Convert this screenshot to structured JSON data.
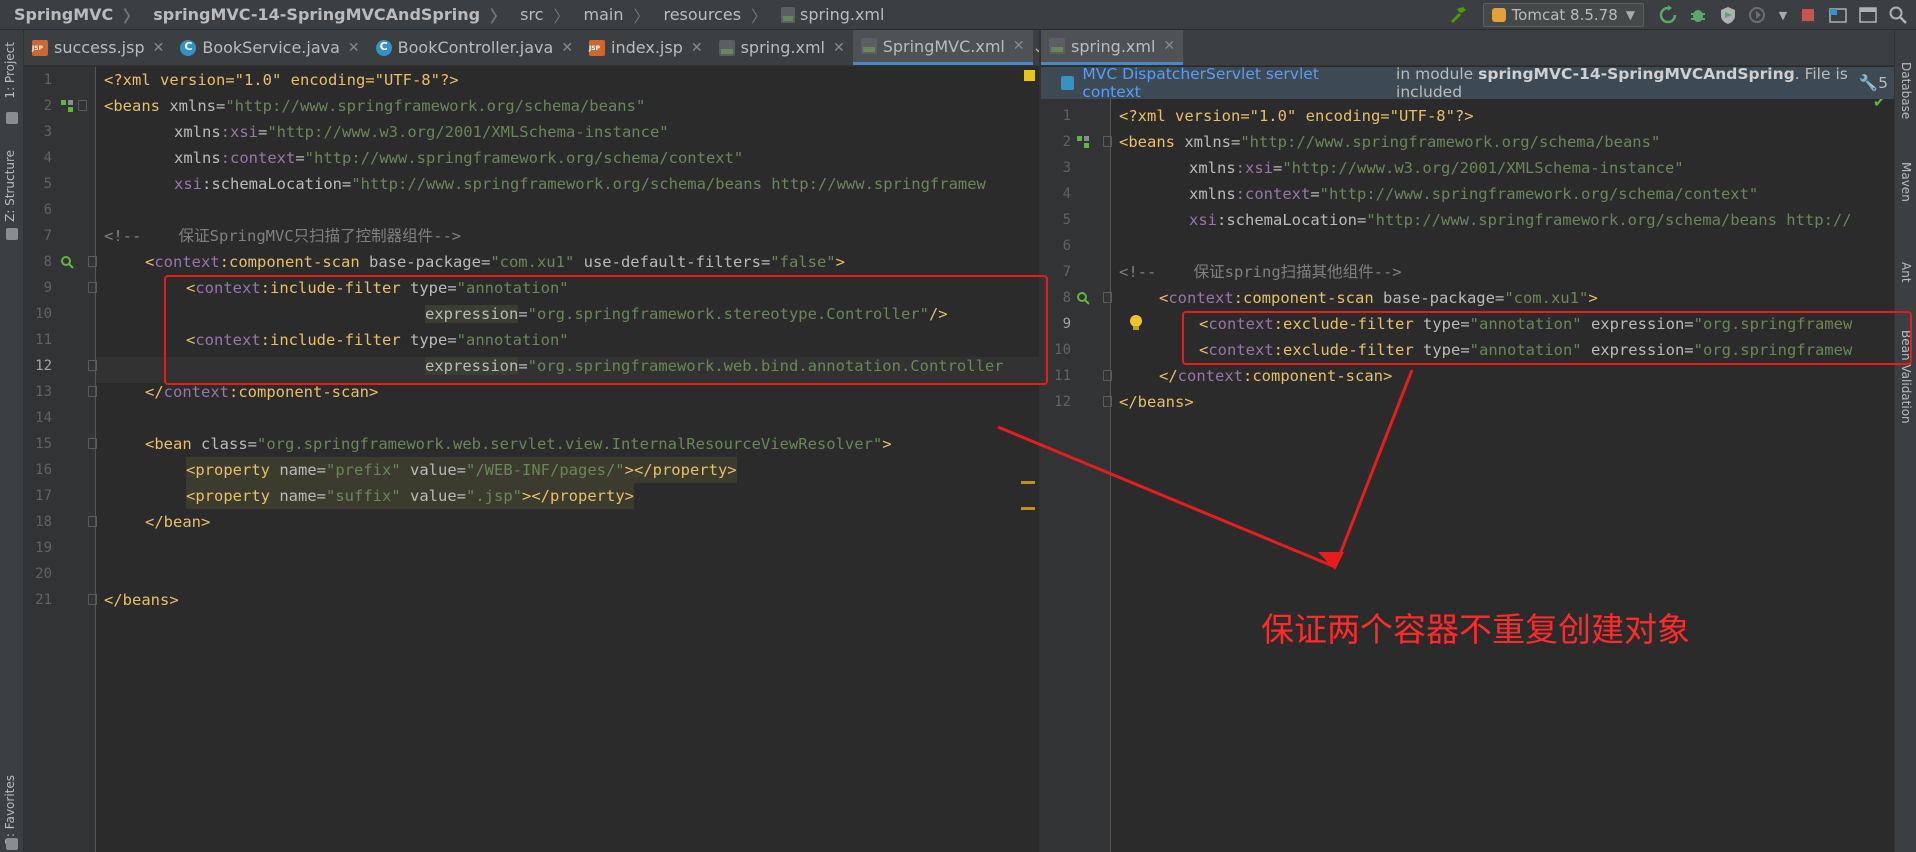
{
  "breadcrumb": [
    "SpringMVC",
    "springMVC-14-SpringMVCAndSpring",
    "src",
    "main",
    "resources",
    "spring.xml"
  ],
  "toolbar": {
    "run_config": "Tomcat 8.5.78"
  },
  "left_tools": [
    "1: Project",
    "Z: Structure",
    "2: Favorites"
  ],
  "right_tools": [
    "Database",
    "Maven",
    "Ant",
    "Bean Validation"
  ],
  "left_tabs": [
    {
      "label": "success.jsp",
      "icon": "jsp"
    },
    {
      "label": "BookService.java",
      "icon": "java"
    },
    {
      "label": "BookController.java",
      "icon": "java"
    },
    {
      "label": "index.jsp",
      "icon": "jsp"
    },
    {
      "label": "spring.xml",
      "icon": "xml"
    },
    {
      "label": "SpringMVC.xml",
      "icon": "xml"
    }
  ],
  "right_tabs": [
    {
      "label": "spring.xml",
      "icon": "xml"
    }
  ],
  "banner": {
    "context": "MVC DispatcherServlet servlet context",
    "module_prefix": "in module ",
    "module_name": "springMVC-14-SpringMVCAndSpring",
    "module_suffix": ". File is included",
    "count": "5"
  },
  "left_lines": [
    "1",
    "2",
    "3",
    "4",
    "5",
    "6",
    "7",
    "8",
    "9",
    "10",
    "11",
    "12",
    "13",
    "14",
    "15",
    "16",
    "17",
    "18",
    "19",
    "20",
    "21"
  ],
  "left_code": {
    "l1": "<?xml version=\"1.0\" encoding=\"UTF-8\"?>",
    "l2a": "<beans ",
    "l2b": "xmlns",
    "l2c": "=",
    "l2d": "\"http://www.springframework.org/schema/beans\"",
    "l3a": "xmlns",
    "l3b": ":xsi",
    "l3c": "=",
    "l3d": "\"http://www.w3.org/2001/XMLSchema-instance\"",
    "l4a": "xmlns",
    "l4b": ":context",
    "l4c": "=",
    "l4d": "\"http://www.springframework.org/schema/context\"",
    "l5a": "xsi",
    "l5b": ":schemaLocation",
    "l5c": "=",
    "l5d": "\"http://www.springframework.org/schema/beans http://www.springframew",
    "l7": "<!--    保证SpringMVC只扫描了控制器组件-->",
    "l8a": "<",
    "l8b": "context",
    "l8c": ":component-scan ",
    "l8d": "base-package",
    "l8e": "=",
    "l8f": "\"com.xu1\"",
    "l8g": " use-default-filters",
    "l8h": "=",
    "l8i": "\"false\"",
    "l8j": ">",
    "l9a": "<",
    "l9b": "context",
    "l9c": ":include-filter ",
    "l9d": "type",
    "l9e": "=",
    "l9f": "\"annotation\"",
    "l10a": "expression",
    "l10b": "=",
    "l10c": "\"org.springframework.stereotype.Controller\"",
    "l10d": "/>",
    "l11a": "<",
    "l11b": "context",
    "l11c": ":include-filter ",
    "l11d": "type",
    "l11e": "=",
    "l11f": "\"annotation\"",
    "l12a": "expression",
    "l12b": "=",
    "l12c": "\"org.springframework.web.bind.annotation.Controller",
    "l13a": "</",
    "l13b": "context",
    "l13c": ":component-scan>",
    "l15a": "<bean ",
    "l15b": "class",
    "l15c": "=",
    "l15d": "\"org.springframework.web.servlet.view.InternalResourceViewResolver\"",
    "l15e": ">",
    "l16a": "<property ",
    "l16b": "name",
    "l16c": "=",
    "l16d": "\"prefix\"",
    "l16e": " value",
    "l16f": "=",
    "l16g": "\"/WEB-INF/pages/\"",
    "l16h": "></property>",
    "l17a": "<property ",
    "l17b": "name",
    "l17c": "=",
    "l17d": "\"suffix\"",
    "l17e": " value",
    "l17f": "=",
    "l17g": "\".jsp\"",
    "l17h": "></property>",
    "l18": "</bean>",
    "l21": "</beans>"
  },
  "right_lines": [
    "1",
    "2",
    "3",
    "4",
    "5",
    "6",
    "7",
    "8",
    "9",
    "10",
    "11",
    "12"
  ],
  "right_code": {
    "r1": "<?xml version=\"1.0\" encoding=\"UTF-8\"?>",
    "r2a": "<beans ",
    "r2b": "xmlns",
    "r2c": "=",
    "r2d": "\"http://www.springframework.org/schema/beans\"",
    "r3a": "xmlns",
    "r3b": ":xsi",
    "r3c": "=",
    "r3d": "\"http://www.w3.org/2001/XMLSchema-instance\"",
    "r4a": "xmlns",
    "r4b": ":context",
    "r4c": "=",
    "r4d": "\"http://www.springframework.org/schema/context\"",
    "r5a": "xsi",
    "r5b": ":schemaLocation",
    "r5c": "=",
    "r5d": "\"http://www.springframework.org/schema/beans http://",
    "r7": "<!--    保证spring扫描其他组件-->",
    "r8a": "<",
    "r8b": "context",
    "r8c": ":component-scan ",
    "r8d": "base-package",
    "r8e": "=",
    "r8f": "\"com.xu1\"",
    "r8g": ">",
    "r9a": "<",
    "r9b": "context",
    "r9c": ":exclude-filter ",
    "r9d": "type",
    "r9e": "=",
    "r9f": "\"annotation\"",
    "r9g": " expression",
    "r9h": "=",
    "r9i": "\"org.springframew",
    "r10a": "<",
    "r10b": "context",
    "r10c": ":exclude-filter ",
    "r10d": "type",
    "r10e": "=",
    "r10f": "\"annotation\"",
    "r10g": " expression",
    "r10h": "=",
    "r10i": "\"org.springframew",
    "r11a": "</",
    "r11b": "context",
    "r11c": ":component-scan>",
    "r12": "</beans>"
  },
  "annotation_text": "保证两个容器不重复创建对象",
  "colors": {
    "background": "#2b2b2b",
    "tag": "#e8bf6a",
    "namespace": "#9876aa",
    "string": "#6a8759",
    "comment": "#808080",
    "annotation": "#e51d1d",
    "accent": "#4a88c7"
  }
}
